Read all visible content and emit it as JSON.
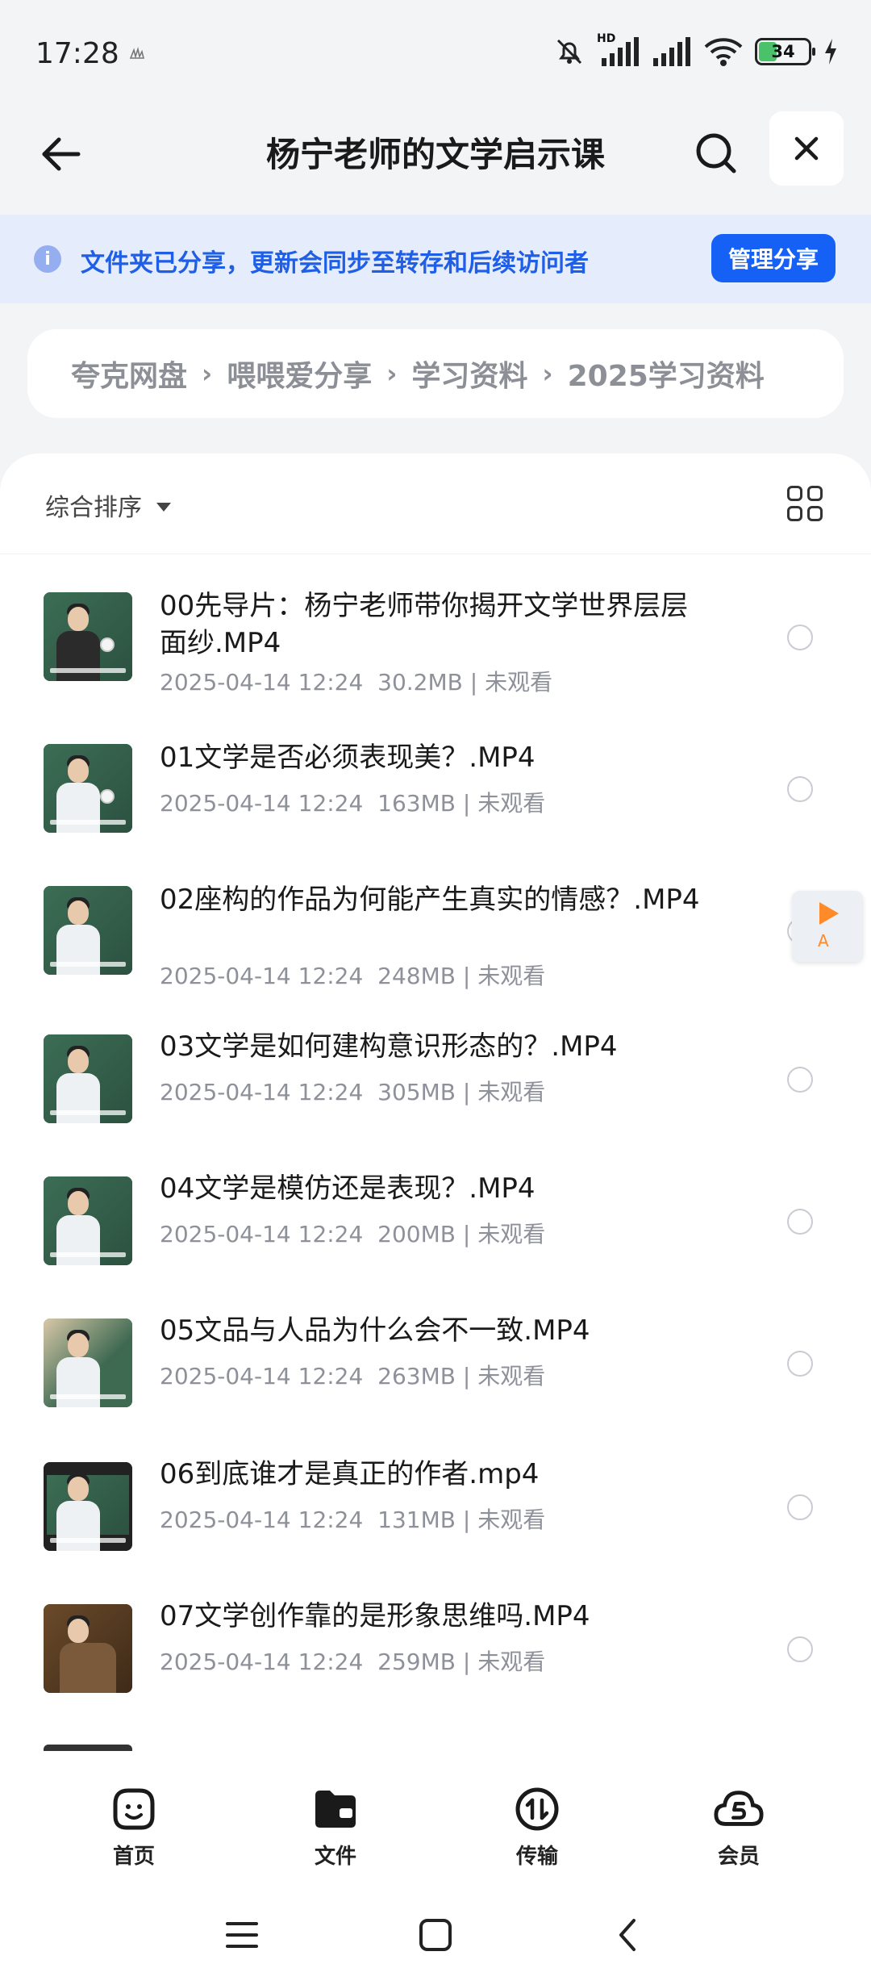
{
  "status_bar": {
    "time": "17:28",
    "network_label": "HD",
    "battery_level": "34"
  },
  "header": {
    "title": "杨宁老师的文学启示课"
  },
  "share_banner": {
    "text": "文件夹已分享，更新会同步至转存和后续访问者",
    "manage_label": "管理分享"
  },
  "breadcrumb": [
    "夸克网盘",
    "喂喂爱分享",
    "学习资料",
    "2025学习资料"
  ],
  "toolbar": {
    "sort_label": "综合排序"
  },
  "files": [
    {
      "name": "00先导片：杨宁老师带你揭开文学世界层层面纱.MP4",
      "date": "2025-04-14 12:24",
      "size": "30.2MB",
      "status": "未观看"
    },
    {
      "name": "01文学是否必须表现美？.MP4",
      "date": "2025-04-14 12:24",
      "size": "163MB",
      "status": "未观看"
    },
    {
      "name": "02座构的作品为何能产生真实的情感？.MP4",
      "date": "2025-04-14 12:24",
      "size": "248MB",
      "status": "未观看"
    },
    {
      "name": "03文学是如何建构意识形态的？.MP4",
      "date": "2025-04-14 12:24",
      "size": "305MB",
      "status": "未观看"
    },
    {
      "name": "04文学是模仿还是表现？.MP4",
      "date": "2025-04-14 12:24",
      "size": "200MB",
      "status": "未观看"
    },
    {
      "name": "05文品与人品为什么会不一致.MP4",
      "date": "2025-04-14 12:24",
      "size": "263MB",
      "status": "未观看"
    },
    {
      "name": "06到底谁才是真正的作者.mp4",
      "date": "2025-04-14 12:24",
      "size": "131MB",
      "status": "未观看"
    },
    {
      "name": "07文学创作靠的是形象思维吗.MP4",
      "date": "2025-04-14 12:24",
      "size": "259MB",
      "status": "未观看"
    }
  ],
  "float_player": {
    "label": "A"
  },
  "tabbar": [
    {
      "label": "首页",
      "icon": "home-face-icon"
    },
    {
      "label": "文件",
      "icon": "folder-icon"
    },
    {
      "label": "传输",
      "icon": "transfer-icon"
    },
    {
      "label": "会员",
      "icon": "cloud-vip-icon"
    }
  ],
  "colors": {
    "accent": "#1560f5",
    "banner_bg": "#e5ecfb",
    "banner_text": "#1f5ee6",
    "page_bg": "#f3f4f6"
  }
}
